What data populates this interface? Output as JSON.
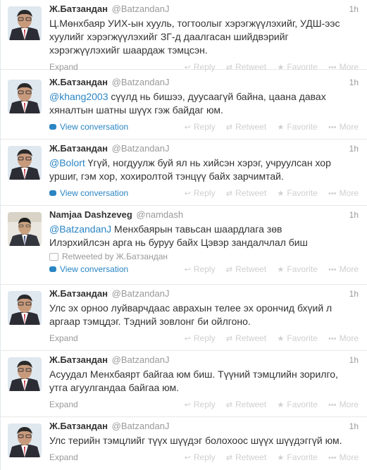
{
  "actions": {
    "reply": "Reply",
    "retweet": "Retweet",
    "favorite": "Favorite",
    "more": "More"
  },
  "tweets": [
    {
      "fullname": "Ж.Батзандан",
      "username": "@BatzandanJ",
      "time": "1h",
      "text_lines": [
        "Ц.Мөнхбаяр УИХ-ын хууль, тогтоолыг хэрэгжүүлэхийг, УДШ-ээс",
        "хуулийг хэрэгжүүлэхийг ЗГ-д даалгасан шийдвэрийг",
        "хэрэгжүүлэхийг шаардаж тэмцсэн."
      ],
      "footer": "Expand"
    },
    {
      "fullname": "Ж.Батзандан",
      "username": "@BatzandanJ",
      "time": "1h",
      "mention": "@khang2003",
      "text_lines": [
        " сүүлд нь бишээ, дуусаагүй байна, цаана давах",
        "хяналтын шатны шүүх гэж байдаг юм."
      ],
      "footer": "View conversation"
    },
    {
      "fullname": "Ж.Батзандан",
      "username": "@BatzandanJ",
      "time": "1h",
      "mention": "@Bolort",
      "text_lines": [
        " Үгүй, ногдуулж буй ял нь хийсэн хэрэг, учруулсан хор",
        "уршиг, гэм хор, хохиролтой тэнцүү байх зарчимтай."
      ],
      "footer": "View conversation"
    },
    {
      "fullname": "Namjaa Dashzeveg",
      "username": "@namdash",
      "time": "1h",
      "mention": "@BatzandanJ",
      "text_lines": [
        " Менхбаярын тавьсан шаардлага зөв",
        "Илэрхийлсэн арга нь буруу байх Цэвэр зандалчлал биш"
      ],
      "retweeted_by": "Retweeted by Ж.Батзандан",
      "footer": "View conversation"
    },
    {
      "fullname": "Ж.Батзандан",
      "username": "@BatzandanJ",
      "time": "1h",
      "text_lines": [
        "Улс эх орноо луйварчдаас аврахын телее эх орончид бхүий л",
        "аргаар тэмцдэг. Тэдний зовлонг би ойлгоно."
      ],
      "footer": "Expand"
    },
    {
      "fullname": "Ж.Батзандан",
      "username": "@BatzandanJ",
      "time": "1h",
      "text_lines": [
        "Асуудал Менхбаярт байгаа юм биш. Түүний тэмцлийн зорилго,",
        "утга агуулгандаа байгаа юм."
      ],
      "footer": "Expand"
    },
    {
      "fullname": "Ж.Батзандан",
      "username": "@BatzandanJ",
      "time": "1h",
      "text_lines": [
        "Улс терийн тэмцлийг түүх шүүдэг болохоос шүүх шүүдэггүй юм."
      ],
      "footer": "Expand"
    }
  ]
}
